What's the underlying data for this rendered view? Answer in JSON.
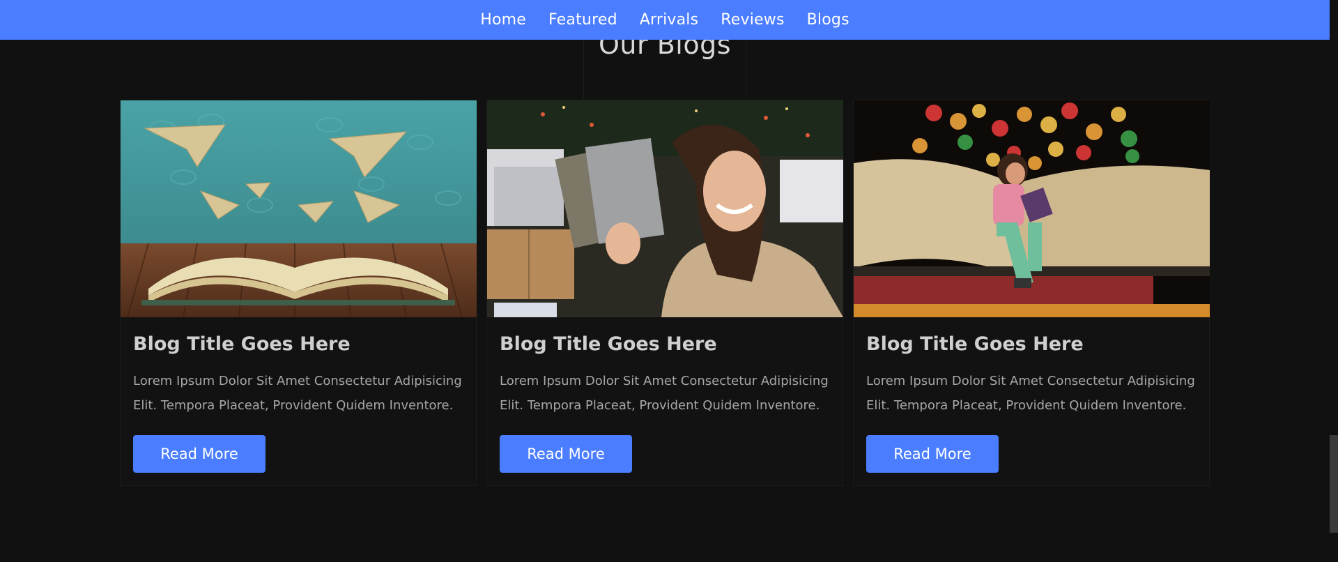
{
  "nav": {
    "items": [
      "Home",
      "Featured",
      "Arrivals",
      "Reviews",
      "Blogs"
    ]
  },
  "section": {
    "heading": "Our Blogs"
  },
  "cards": [
    {
      "title": "Blog Title Goes Here",
      "excerpt": "Lorem Ipsum Dolor Sit Amet Consectetur Adipisicing Elit. Tempora Placeat, Provident Quidem Inventore.",
      "button_label": "Read More",
      "image": "open-book-paper-planes"
    },
    {
      "title": "Blog Title Goes Here",
      "excerpt": "Lorem Ipsum Dolor Sit Amet Consectetur Adipisicing Elit. Tempora Placeat, Provident Quidem Inventore.",
      "button_label": "Read More",
      "image": "woman-holding-books"
    },
    {
      "title": "Blog Title Goes Here",
      "excerpt": "Lorem Ipsum Dolor Sit Amet Consectetur Adipisicing Elit. Tempora Placeat, Provident Quidem Inventore.",
      "button_label": "Read More",
      "image": "girl-reading-on-book-bokeh"
    }
  ],
  "colors": {
    "accent": "#4a7dff",
    "background": "#111111",
    "title_text": "#cfcfcf",
    "body_text": "#a7a7a7"
  }
}
